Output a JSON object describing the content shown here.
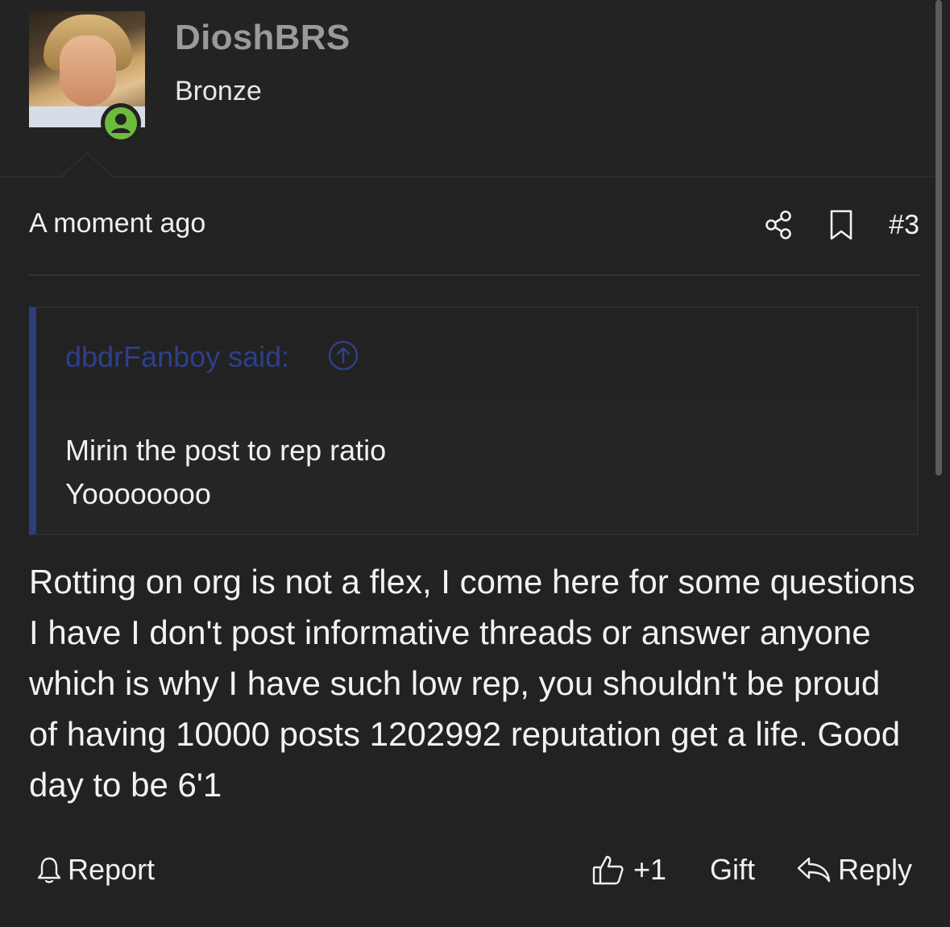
{
  "user": {
    "name": "DioshBRS",
    "title": "Bronze"
  },
  "post": {
    "time": "A moment ago",
    "number": "#3",
    "quote": {
      "author": "dbdrFanboy said:",
      "lines": [
        "Mirin the post to rep ratio",
        "Yoooooooo"
      ]
    },
    "body": "Rotting on org is not a flex, I come here for some questions I have I don't post informative threads or answer anyone which is why I have such low rep, you shouldn't be proud of having 10000 posts 1202992 reputation get a life. Good day to be 6'1"
  },
  "actions": {
    "report": "Report",
    "like_count": "+1",
    "gift": "Gift",
    "reply": "Reply"
  },
  "icons": {
    "status": "user-online-icon",
    "share": "share-icon",
    "bookmark": "bookmark-icon",
    "quote_jump": "arrow-up-circle-icon",
    "report": "bell-icon",
    "like": "thumbs-up-icon",
    "reply": "reply-arrow-icon"
  },
  "colors": {
    "background": "#222222",
    "username": "#9a9a9a",
    "quote_accent": "#2f3d7a",
    "quote_author": "#2f3f8c",
    "online": "#6dbb3c"
  }
}
